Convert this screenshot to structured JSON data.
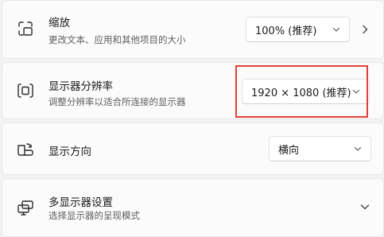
{
  "rows": [
    {
      "title": "缩放",
      "subtitle": "更改文本、应用和其他项目的大小",
      "icon": "zoom-frame-icon",
      "dropdown_value": "100% (推荐)",
      "trailing_icon": "chevron-right-icon"
    },
    {
      "title": "显示器分辨率",
      "subtitle": "调整分辨率以适合所连接的显示器",
      "icon": "resolution-icon",
      "dropdown_value": "1920 × 1080 (推荐)"
    },
    {
      "title": "显示方向",
      "icon": "orientation-icon",
      "dropdown_value": "横向"
    },
    {
      "title": "多显示器设置",
      "subtitle": "选择显示器的呈现模式",
      "icon": "multi-display-icon",
      "trailing_icon": "chevron-down-icon"
    }
  ],
  "colors": {
    "background": "#f3f3f3",
    "card": "#fbfbfb",
    "highlight_border": "#e0403a"
  }
}
